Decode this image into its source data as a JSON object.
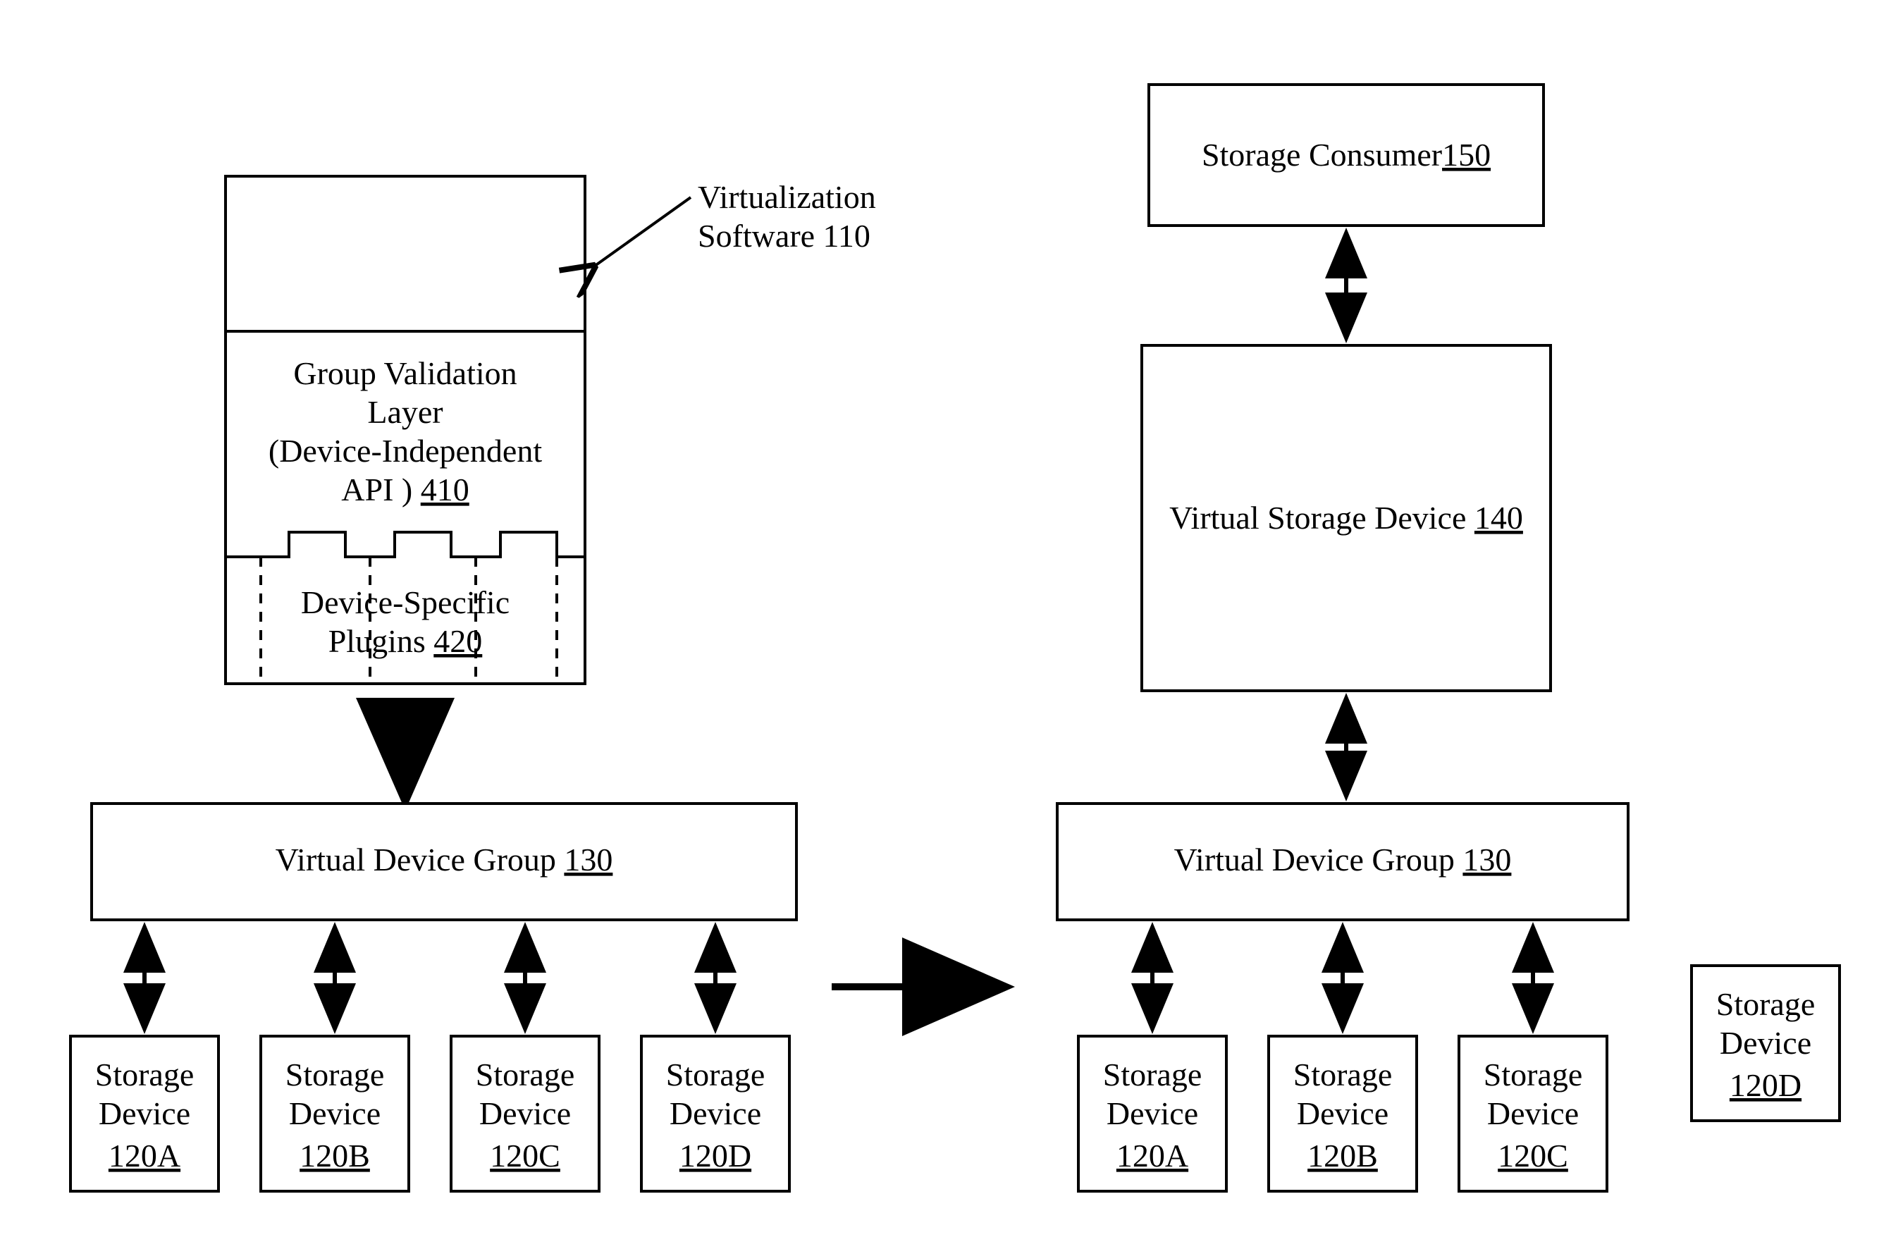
{
  "labels": {
    "callout_line1": "Virtualization",
    "callout_line2": "Software 110",
    "layer_line1": "Group Validation",
    "layer_line2": "Layer",
    "layer_line3": "(Device-Independent",
    "layer_line4_pre": "API ) ",
    "layer_line4_ref": "410",
    "plugins_line1": "Device-Specific",
    "plugins_line2_pre": "Plugins ",
    "plugins_line2_ref": "420",
    "vdg_pre": "Virtual Device Group ",
    "vdg_ref": "130",
    "consumer_pre": "Storage Consumer",
    "consumer_ref": "150",
    "vsd_pre": "Virtual Storage Device ",
    "vsd_ref": "140",
    "storage_line1": "Storage",
    "storage_line2": "Device",
    "d120A": "120A",
    "d120B": "120B",
    "d120C": "120C",
    "d120D": "120D"
  }
}
